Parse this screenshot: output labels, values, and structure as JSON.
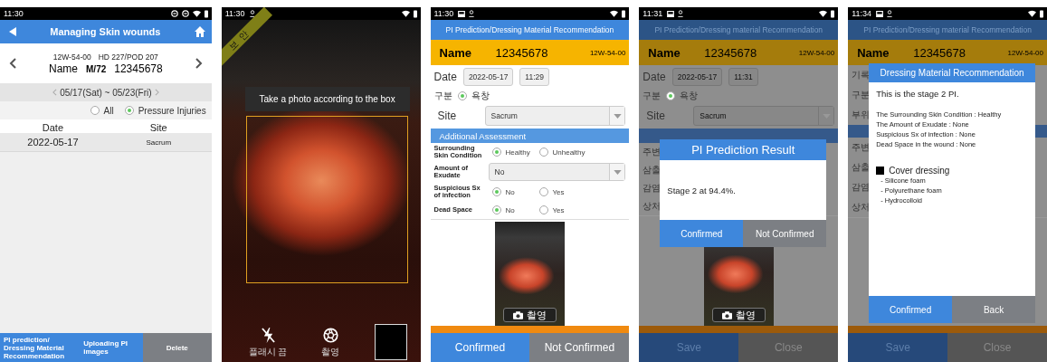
{
  "screens": [
    {
      "kind": "patient_list",
      "status_time": "11:30",
      "header": {
        "title": "Managing Skin wounds"
      },
      "patient": {
        "ward": "12W-54-00",
        "visit": "HD 227/POD 207",
        "name": "Name",
        "sex_age": "M/72",
        "id": "12345678"
      },
      "week": "05/17(Sat) ~ 05/23(Fri)",
      "filters": [
        {
          "label": "All",
          "selected": false
        },
        {
          "label": "Pressure Injuries",
          "selected": true
        }
      ],
      "table": {
        "columns": [
          "Date",
          "Site"
        ],
        "rows": [
          [
            "2022-05-17",
            "Sacrum"
          ]
        ]
      },
      "buttons": [
        {
          "label": "PI prediction/ Dressing Material Recommendation",
          "kind": "primary"
        },
        {
          "label": "Uploading PI images",
          "kind": "primary"
        },
        {
          "label": "Delete",
          "kind": "secondary"
        }
      ]
    },
    {
      "kind": "camera",
      "status_time": "11:30",
      "ribbon": "보안",
      "guide": "Take a photo according to the box",
      "controls": [
        {
          "kind": "flash",
          "label": "플래시 끔"
        },
        {
          "kind": "shutter",
          "label": "촬영"
        },
        {
          "kind": "thumbnail"
        }
      ]
    },
    {
      "kind": "form",
      "dimmed": false,
      "status_time": "11:30",
      "title": "PI Prediction/Dressing Material Recommendation",
      "name_bar": {
        "label": "Name",
        "id": "12345678",
        "ward": "12W-54-00"
      },
      "rows": [
        {
          "kind": "date",
          "label": "Date",
          "date": "2022-05-17",
          "time": "11:29"
        },
        {
          "kind": "category",
          "label": "구분",
          "options": [
            {
              "label": "욕창",
              "selected": true
            }
          ]
        },
        {
          "kind": "site_select",
          "label": "Site",
          "value": "Sacrum"
        },
        {
          "kind": "section",
          "title": "Additional Assessment"
        },
        {
          "kind": "assess_radio",
          "label": "Surrounding Skin Condition",
          "options": [
            {
              "label": "Healthy",
              "selected": true
            },
            {
              "label": "Unhealthy",
              "selected": false
            }
          ]
        },
        {
          "kind": "assess_select",
          "label": "Amount of Exudate",
          "value": "No"
        },
        {
          "kind": "assess_radio",
          "label": "Suspicious Sx of infection",
          "options": [
            {
              "label": "No",
              "selected": true
            },
            {
              "label": "Yes",
              "selected": false
            }
          ]
        },
        {
          "kind": "assess_radio",
          "label": "Dead Space",
          "options": [
            {
              "label": "No",
              "selected": true
            },
            {
              "label": "Yes",
              "selected": false
            }
          ]
        }
      ],
      "photo": {
        "button": "촬영"
      },
      "buttons": [
        {
          "label": "Confirmed",
          "kind": "primary"
        },
        {
          "label": "Not Confirmed",
          "kind": "secondary"
        }
      ]
    },
    {
      "kind": "form",
      "dimmed": true,
      "status_time": "11:31",
      "title": "PI Prediction/Dressing material Recommendation",
      "name_bar": {
        "label": "Name",
        "id": "12345678",
        "ward": "12W-54-00"
      },
      "rows": [
        {
          "kind": "date",
          "label": "Date",
          "date": "2022-05-17",
          "time": "11:31"
        },
        {
          "kind": "category",
          "label": "구분",
          "options": [
            {
              "label": "욕창",
              "selected": true
            }
          ]
        },
        {
          "kind": "site_select",
          "label": "Site",
          "value": "Sacrum"
        },
        {
          "kind": "section"
        },
        {
          "kind": "label",
          "text": "주변"
        },
        {
          "kind": "label",
          "text": "삼출"
        },
        {
          "kind": "label",
          "text": "감염"
        },
        {
          "kind": "label",
          "text": "상처"
        }
      ],
      "photo": {
        "button": "촬영"
      },
      "buttons": [
        {
          "label": "Save",
          "kind": "primary"
        },
        {
          "label": "Close",
          "kind": "secondary"
        }
      ],
      "dialog": {
        "kind": "result",
        "title": "PI Prediction Result",
        "paragraphs": [
          {
            "kind": "lead",
            "text": "Stage 2 at 94.4%."
          }
        ],
        "buttons": [
          {
            "label": "Confirmed",
            "kind": "primary"
          },
          {
            "label": "Not Confirmed",
            "kind": "secondary"
          }
        ]
      }
    },
    {
      "kind": "form",
      "dimmed": true,
      "status_time": "11:34",
      "title": "PI Prediction/Dressing material Recommendation",
      "name_bar": {
        "label": "Name",
        "id": "12345678",
        "ward": "12W-54-00"
      },
      "rows": [
        {
          "kind": "label",
          "text": "기록"
        },
        {
          "kind": "label",
          "text": "구분"
        },
        {
          "kind": "label",
          "text": "부위"
        },
        {
          "kind": "section"
        },
        {
          "kind": "label",
          "text": "주변"
        },
        {
          "kind": "label",
          "text": "삼출"
        },
        {
          "kind": "label",
          "text": "감염"
        },
        {
          "kind": "label",
          "text": "상처"
        }
      ],
      "buttons": [
        {
          "label": "Save",
          "kind": "primary"
        },
        {
          "label": "Close",
          "kind": "secondary"
        }
      ],
      "dialog": {
        "kind": "recommendation",
        "title": "Dressing Material Recommendation",
        "paragraphs": [
          {
            "kind": "lead",
            "text": "This is the stage 2 PI."
          },
          {
            "kind": "detail",
            "text": "The Surrounding Skin Condition : Healthy"
          },
          {
            "kind": "detail",
            "text": "The Amount of Exudate : None"
          },
          {
            "kind": "detail",
            "text": "Suspicious Sx of infection : None"
          },
          {
            "kind": "detail",
            "text": "Dead Space in the wound : None"
          },
          {
            "kind": "heading",
            "text": "Cover dressing"
          },
          {
            "kind": "item",
            "text": "- Silicone foam"
          },
          {
            "kind": "item",
            "text": "- Polyurethane foam"
          },
          {
            "kind": "item",
            "text": "- Hydrocolloid"
          }
        ],
        "buttons": [
          {
            "label": "Confirmed",
            "kind": "primary"
          },
          {
            "label": "Back",
            "kind": "secondary"
          }
        ]
      }
    }
  ]
}
